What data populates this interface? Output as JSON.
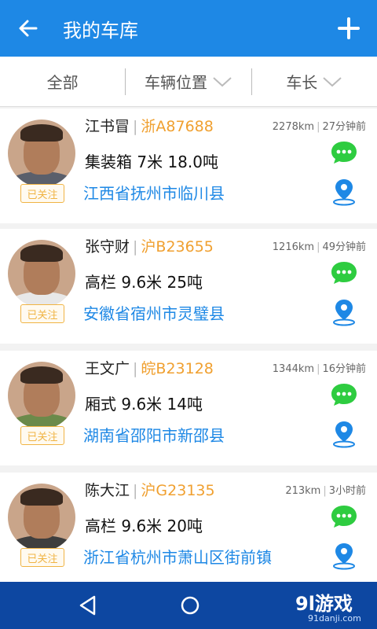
{
  "appbar": {
    "title": "我的车库"
  },
  "filters": [
    {
      "label": "全部",
      "has_dropdown": false
    },
    {
      "label": "车辆位置",
      "has_dropdown": true
    },
    {
      "label": "车长",
      "has_dropdown": true
    }
  ],
  "drivers": [
    {
      "name": "江书冒",
      "plate": "浙A87688",
      "distance": "2278km",
      "time": "27分钟前",
      "cargo": "集装箱 7米 18.0吨",
      "location": "江西省抚州市临川县",
      "followed": "已关注"
    },
    {
      "name": "张守财",
      "plate": "沪B23655",
      "distance": "1216km",
      "time": "49分钟前",
      "cargo": "高栏 9.6米 25吨",
      "location": "安徽省宿州市灵璧县",
      "followed": "已关注"
    },
    {
      "name": "王文广",
      "plate": "皖B23128",
      "distance": "1344km",
      "time": "16分钟前",
      "cargo": "厢式 9.6米 14吨",
      "location": "湖南省邵阳市新邵县",
      "followed": "已关注"
    },
    {
      "name": "陈大江",
      "plate": "沪G23135",
      "distance": "213km",
      "time": "3小时前",
      "cargo": "高栏 9.6米 20吨",
      "location": "浙江省杭州市萧山区街前镇",
      "followed": "已关注"
    }
  ],
  "watermark": {
    "brand": "9l游戏",
    "url": "91danji.com"
  },
  "colors": {
    "primary": "#1e88e5",
    "plate": "#f0a030",
    "chat": "#2ecc40",
    "navbar": "#0d47a1"
  },
  "icons": {
    "back": "arrow-left-icon",
    "add": "plus-icon",
    "chat": "chat-bubble-icon",
    "location": "location-pin-icon"
  }
}
